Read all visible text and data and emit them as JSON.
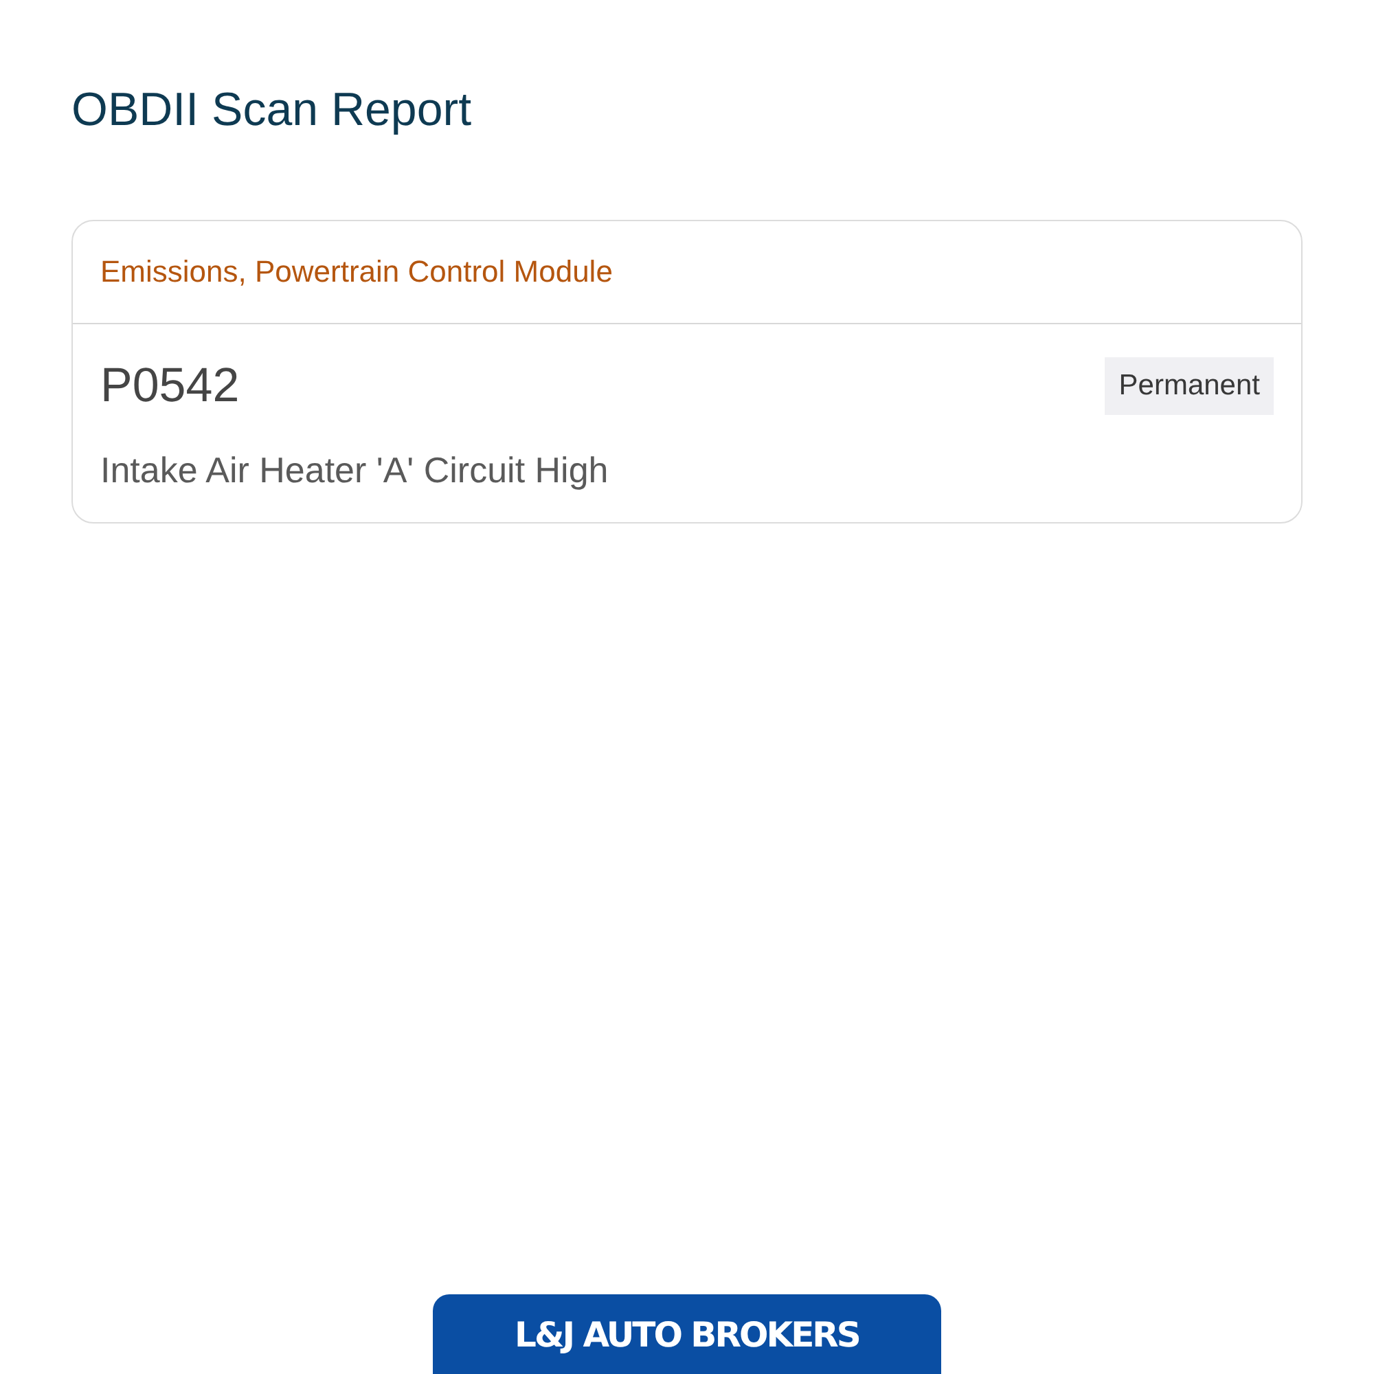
{
  "title": "OBDII Scan Report",
  "trouble_codes": [
    {
      "category": "Emissions, Powertrain Control Module",
      "code": "P0542",
      "status": "Permanent",
      "description": "Intake Air Heater 'A' Circuit High"
    }
  ],
  "footer_logo": {
    "text": "L&J AUTO BROKERS"
  }
}
